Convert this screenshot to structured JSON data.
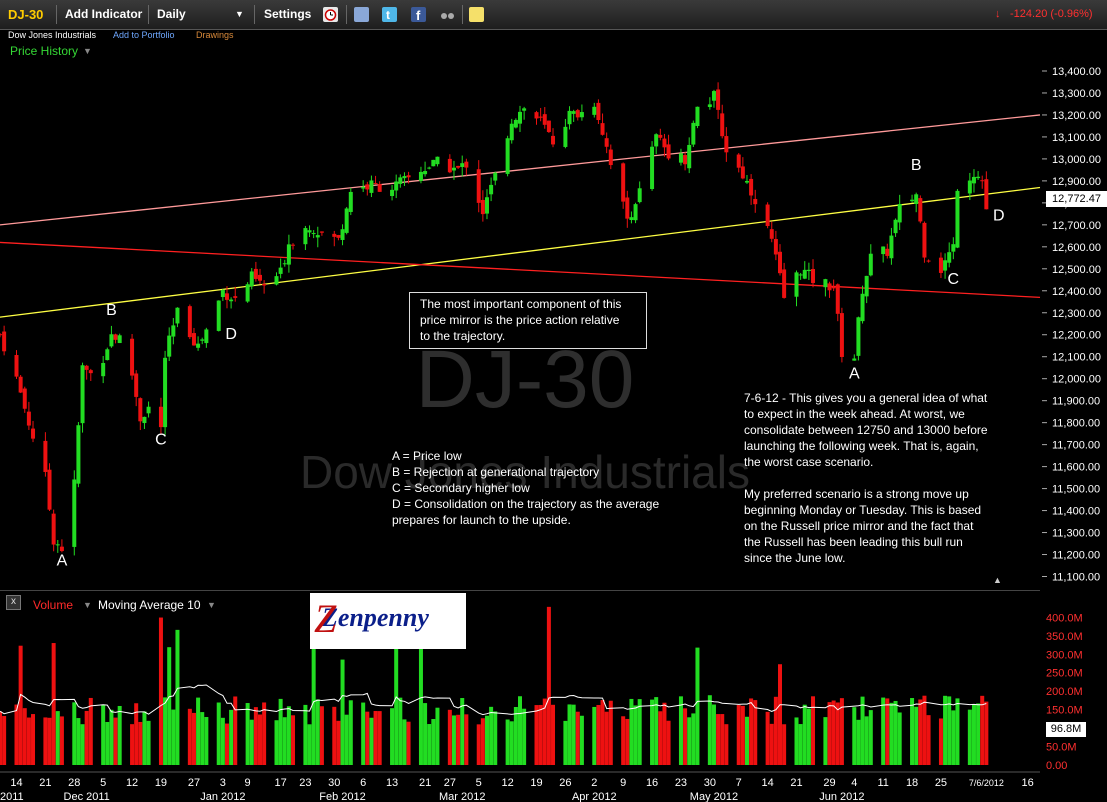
{
  "toolbar": {
    "symbol": "DJ-30",
    "add_indicator": "Add Indicator",
    "interval": "Daily",
    "settings": "Settings",
    "change": "-124.20 (-0.96%)"
  },
  "subbar": {
    "name": "Dow Jones Industrials",
    "add_portfolio": "Add to Portfolio",
    "drawings": "Drawings"
  },
  "price_panel": {
    "label": "Price History",
    "watermark_symbol": "DJ-30",
    "watermark_name": "Dow Jones Industrials",
    "last_price": "12,772.47"
  },
  "volume_panel": {
    "close_label": "x",
    "label": "Volume",
    "ma_label": "Moving Average 10",
    "last_volume": "96.8M",
    "logo_text": "Zenpenny"
  },
  "annotations": {
    "box": "The most important component of this\nprice mirror is the price action relative\nto the trajectory.",
    "legend": "A = Price low\nB = Rejection at generational trajectory\nC = Secondary higher low\nD = Consolidation on the trajectory as the average\nprepares for launch to the upside.",
    "commentary": "7-6-12 - This gives you a general idea of what\nto expect in the week ahead. At worst, we\nconsolidate between 12750 and 13000 before\nlaunching the following week. That is, again,\nthe worst case scenario.\n\nMy preferred scenario is a strong move up\nbeginning Monday or Tuesday. This is based\non the Russell price mirror and the fact that\nthe Russell has been leading this bull run\nsince the June low."
  },
  "markers": [
    {
      "label": "A",
      "date": "2011-11-25",
      "price": 11150
    },
    {
      "label": "B",
      "date": "2011-12-07",
      "price": 12290
    },
    {
      "label": "C",
      "date": "2011-12-19",
      "price": 11700
    },
    {
      "label": "D",
      "date": "2012-01-05",
      "price": 12180
    },
    {
      "label": "A",
      "date": "2012-06-04",
      "price": 12000
    },
    {
      "label": "B",
      "date": "2012-06-19",
      "price": 12950
    },
    {
      "label": "C",
      "date": "2012-06-28",
      "price": 12430
    },
    {
      "label": "D",
      "date": "2012-07-09",
      "price": 12720
    }
  ],
  "chart_data": {
    "type": "candlestick",
    "y_ticks": [
      "13,400.00",
      "13,300.00",
      "13,200.00",
      "13,100.00",
      "13,000.00",
      "12,900.00",
      "12,800.00",
      "12,700.00",
      "12,600.00",
      "12,500.00",
      "12,400.00",
      "12,300.00",
      "12,200.00",
      "12,100.00",
      "12,000.00",
      "11,900.00",
      "11,800.00",
      "11,700.00",
      "11,600.00",
      "11,500.00",
      "11,400.00",
      "11,300.00",
      "11,200.00",
      "11,100.00"
    ],
    "y_range": [
      11075,
      13450
    ],
    "volume_ticks": [
      "400.0M",
      "350.0M",
      "300.0M",
      "250.0M",
      "200.0M",
      "150.0M",
      "100.0M",
      "50.0M",
      "0.00"
    ],
    "volume_range": [
      0,
      420
    ],
    "x_range": [
      "2011-11-10",
      "2012-07-19"
    ],
    "x_day_ticks": [
      {
        "label": "14",
        "date": "2011-11-14"
      },
      {
        "label": "21",
        "date": "2011-11-21"
      },
      {
        "label": "28",
        "date": "2011-11-28"
      },
      {
        "label": "5",
        "date": "2011-12-05"
      },
      {
        "label": "12",
        "date": "2011-12-12"
      },
      {
        "label": "19",
        "date": "2011-12-19"
      },
      {
        "label": "27",
        "date": "2011-12-27"
      },
      {
        "label": "3",
        "date": "2012-01-03"
      },
      {
        "label": "9",
        "date": "2012-01-09"
      },
      {
        "label": "17",
        "date": "2012-01-17"
      },
      {
        "label": "23",
        "date": "2012-01-23"
      },
      {
        "label": "30",
        "date": "2012-01-30"
      },
      {
        "label": "6",
        "date": "2012-02-06"
      },
      {
        "label": "13",
        "date": "2012-02-13"
      },
      {
        "label": "21",
        "date": "2012-02-21"
      },
      {
        "label": "27",
        "date": "2012-02-27"
      },
      {
        "label": "5",
        "date": "2012-03-05"
      },
      {
        "label": "12",
        "date": "2012-03-12"
      },
      {
        "label": "19",
        "date": "2012-03-19"
      },
      {
        "label": "26",
        "date": "2012-03-26"
      },
      {
        "label": "2",
        "date": "2012-04-02"
      },
      {
        "label": "9",
        "date": "2012-04-09"
      },
      {
        "label": "16",
        "date": "2012-04-16"
      },
      {
        "label": "23",
        "date": "2012-04-23"
      },
      {
        "label": "30",
        "date": "2012-04-30"
      },
      {
        "label": "7",
        "date": "2012-05-07"
      },
      {
        "label": "14",
        "date": "2012-05-14"
      },
      {
        "label": "21",
        "date": "2012-05-21"
      },
      {
        "label": "29",
        "date": "2012-05-29"
      },
      {
        "label": "4",
        "date": "2012-06-04"
      },
      {
        "label": "11",
        "date": "2012-06-11"
      },
      {
        "label": "18",
        "date": "2012-06-18"
      },
      {
        "label": "25",
        "date": "2012-06-25"
      },
      {
        "label": "7/6/2012",
        "date": "2012-07-06"
      },
      {
        "label": "16",
        "date": "2012-07-16"
      }
    ],
    "x_month_ticks": [
      {
        "label": "2011",
        "date": "2011-11-10"
      },
      {
        "label": "Dec 2011",
        "date": "2011-12-01"
      },
      {
        "label": "Jan 2012",
        "date": "2012-01-03"
      },
      {
        "label": "Feb 2012",
        "date": "2012-02-01"
      },
      {
        "label": "Mar 2012",
        "date": "2012-03-01"
      },
      {
        "label": "Apr 2012",
        "date": "2012-04-02"
      },
      {
        "label": "May 2012",
        "date": "2012-05-01"
      },
      {
        "label": "Jun 2012",
        "date": "2012-06-01"
      }
    ],
    "trendlines": [
      {
        "color": "#ff9a9a",
        "from": {
          "date": "2011-11-10",
          "price": 12700
        },
        "to": {
          "date": "2012-07-19",
          "price": 13200
        }
      },
      {
        "color": "#ffff44",
        "from": {
          "date": "2011-11-10",
          "price": 12280
        },
        "to": {
          "date": "2012-07-19",
          "price": 12870
        }
      },
      {
        "color": "#ff2020",
        "from": {
          "date": "2011-11-10",
          "price": 12620
        },
        "to": {
          "date": "2012-07-19",
          "price": 12370
        }
      }
    ],
    "closes": [
      {
        "date": "2011-11-10",
        "close": 12200
      },
      {
        "date": "2011-11-14",
        "close": 12000
      },
      {
        "date": "2011-11-17",
        "close": 11800
      },
      {
        "date": "2011-11-21",
        "close": 11550
      },
      {
        "date": "2011-11-23",
        "close": 11270
      },
      {
        "date": "2011-11-25",
        "close": 11230
      },
      {
        "date": "2011-11-28",
        "close": 11520
      },
      {
        "date": "2011-11-30",
        "close": 12050
      },
      {
        "date": "2011-12-02",
        "close": 12020
      },
      {
        "date": "2011-12-05",
        "close": 12100
      },
      {
        "date": "2011-12-07",
        "close": 12200
      },
      {
        "date": "2011-12-09",
        "close": 12180
      },
      {
        "date": "2011-12-12",
        "close": 12020
      },
      {
        "date": "2011-12-14",
        "close": 11820
      },
      {
        "date": "2011-12-16",
        "close": 11870
      },
      {
        "date": "2011-12-19",
        "close": 11770
      },
      {
        "date": "2011-12-20",
        "close": 12100
      },
      {
        "date": "2011-12-23",
        "close": 12300
      },
      {
        "date": "2011-12-28",
        "close": 12150
      },
      {
        "date": "2011-12-30",
        "close": 12220
      },
      {
        "date": "2012-01-03",
        "close": 12400
      },
      {
        "date": "2012-01-06",
        "close": 12360
      },
      {
        "date": "2012-01-10",
        "close": 12460
      },
      {
        "date": "2012-01-13",
        "close": 12420
      },
      {
        "date": "2012-01-17",
        "close": 12480
      },
      {
        "date": "2012-01-19",
        "close": 12620
      },
      {
        "date": "2012-01-24",
        "close": 12700
      },
      {
        "date": "2012-01-27",
        "close": 12660
      },
      {
        "date": "2012-01-31",
        "close": 12630
      },
      {
        "date": "2012-02-03",
        "close": 12860
      },
      {
        "date": "2012-02-08",
        "close": 12880
      },
      {
        "date": "2012-02-13",
        "close": 12870
      },
      {
        "date": "2012-02-16",
        "close": 12900
      },
      {
        "date": "2012-02-21",
        "close": 12960
      },
      {
        "date": "2012-02-24",
        "close": 12980
      },
      {
        "date": "2012-02-29",
        "close": 12950
      },
      {
        "date": "2012-03-02",
        "close": 12980
      },
      {
        "date": "2012-03-06",
        "close": 12760
      },
      {
        "date": "2012-03-09",
        "close": 12920
      },
      {
        "date": "2012-03-13",
        "close": 13180
      },
      {
        "date": "2012-03-16",
        "close": 13230
      },
      {
        "date": "2012-03-20",
        "close": 13170
      },
      {
        "date": "2012-03-23",
        "close": 13080
      },
      {
        "date": "2012-03-27",
        "close": 13200
      },
      {
        "date": "2012-03-30",
        "close": 13210
      },
      {
        "date": "2012-04-02",
        "close": 13260
      },
      {
        "date": "2012-04-05",
        "close": 13060
      },
      {
        "date": "2012-04-10",
        "close": 12720
      },
      {
        "date": "2012-04-13",
        "close": 12850
      },
      {
        "date": "2012-04-17",
        "close": 13100
      },
      {
        "date": "2012-04-20",
        "close": 13030
      },
      {
        "date": "2012-04-24",
        "close": 13000
      },
      {
        "date": "2012-04-27",
        "close": 13230
      },
      {
        "date": "2012-05-01",
        "close": 13280
      },
      {
        "date": "2012-05-04",
        "close": 13040
      },
      {
        "date": "2012-05-08",
        "close": 12930
      },
      {
        "date": "2012-05-11",
        "close": 12820
      },
      {
        "date": "2012-05-15",
        "close": 12630
      },
      {
        "date": "2012-05-18",
        "close": 12370
      },
      {
        "date": "2012-05-22",
        "close": 12500
      },
      {
        "date": "2012-05-25",
        "close": 12450
      },
      {
        "date": "2012-05-30",
        "close": 12420
      },
      {
        "date": "2012-06-01",
        "close": 12120
      },
      {
        "date": "2012-06-04",
        "close": 12100
      },
      {
        "date": "2012-06-06",
        "close": 12410
      },
      {
        "date": "2012-06-08",
        "close": 12550
      },
      {
        "date": "2012-06-12",
        "close": 12580
      },
      {
        "date": "2012-06-15",
        "close": 12770
      },
      {
        "date": "2012-06-19",
        "close": 12840
      },
      {
        "date": "2012-06-21",
        "close": 12580
      },
      {
        "date": "2012-06-25",
        "close": 12500
      },
      {
        "date": "2012-06-28",
        "close": 12600
      },
      {
        "date": "2012-06-29",
        "close": 12880
      },
      {
        "date": "2012-07-03",
        "close": 12940
      },
      {
        "date": "2012-07-05",
        "close": 12900
      },
      {
        "date": "2012-07-06",
        "close": 12772
      }
    ]
  }
}
